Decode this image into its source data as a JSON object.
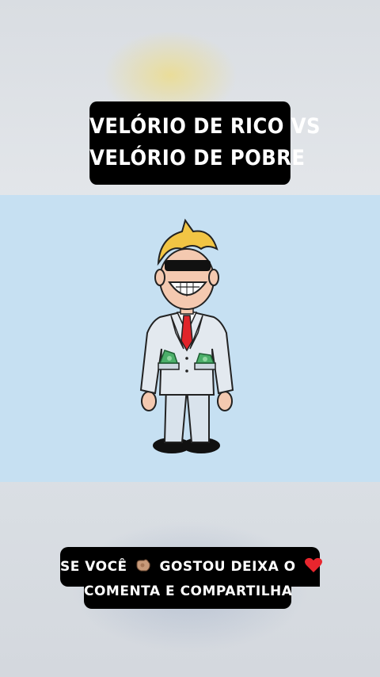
{
  "title": {
    "line1": "VELÓRIO DE RICO VS",
    "line2": "VELÓRIO DE POBRE"
  },
  "caption": {
    "part1": "SE VOCÊ",
    "part2": "GOSTOU DEIXA O",
    "line2": "COMENTA E COMPARTILHA"
  },
  "icons": [
    "pointing-hand-icon",
    "red-heart-icon"
  ],
  "colors": {
    "stage_bg": "#c6e0f2",
    "caption_bg": "#000000",
    "caption_text": "#ffffff",
    "tie": "#e0242a",
    "money": "#4caf6a"
  }
}
